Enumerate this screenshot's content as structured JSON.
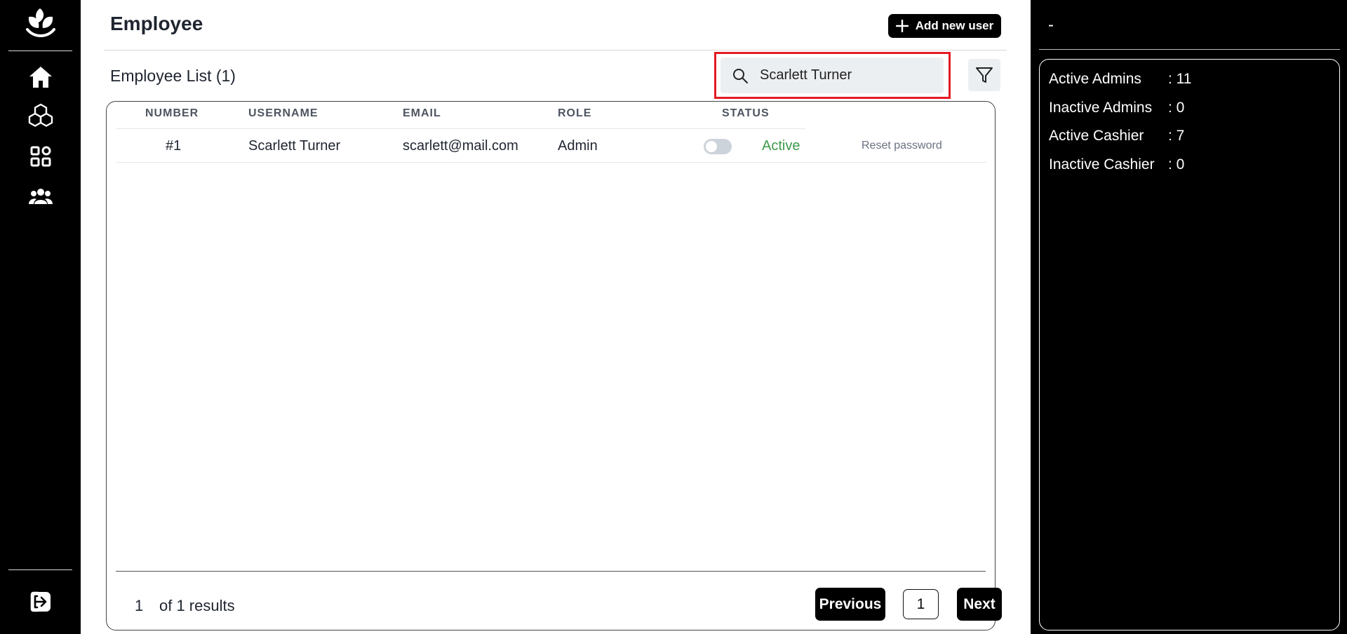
{
  "header": {
    "title": "Employee",
    "add_button_label": "Add new user"
  },
  "list": {
    "title": "Employee List (1)"
  },
  "search": {
    "value": "Scarlett Turner"
  },
  "table": {
    "columns": [
      "NUMBER",
      "USERNAME",
      "EMAIL",
      "ROLE",
      "STATUS"
    ],
    "rows": [
      {
        "number": "#1",
        "username": "Scarlett Turner",
        "email": "scarlett@mail.com",
        "role": "Admin",
        "status": "Active",
        "action": "Reset password"
      }
    ]
  },
  "pagination": {
    "count": "1",
    "results_text": "of 1 results",
    "previous_label": "Previous",
    "page": "1",
    "next_label": "Next"
  },
  "summary": {
    "header": "-",
    "stats": [
      {
        "label": "Active Admins",
        "value": ": 11"
      },
      {
        "label": "Inactive Admins",
        "value": ": 0"
      },
      {
        "label": "Active Cashier",
        "value": ": 7"
      },
      {
        "label": "Inactive Cashier",
        "value": ": 0"
      }
    ]
  },
  "icons": {
    "logo": "leaf-logo-icon",
    "nav": [
      "home-icon",
      "cubes-icon",
      "apps-grid-icon",
      "users-icon"
    ],
    "logout": "logout-icon",
    "search": "search-icon",
    "filter": "filter-icon",
    "add": "plus-icon"
  },
  "colors": {
    "highlight_border": "#e31b23",
    "status_active": "#3e9a4a"
  }
}
